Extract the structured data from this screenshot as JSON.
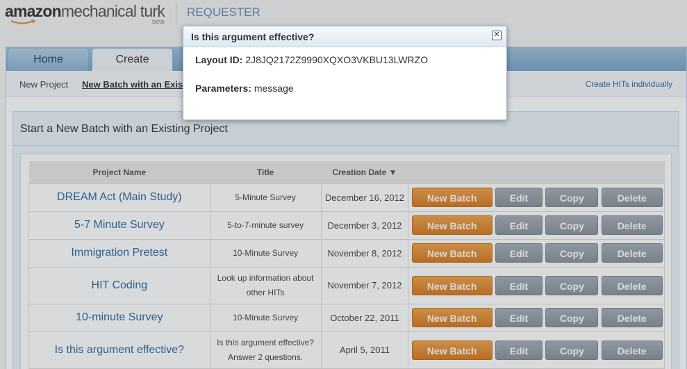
{
  "header": {
    "logo_bold": "amazon",
    "logo_rest": "mechanical turk",
    "logo_badge": "beta",
    "section": "REQUESTER"
  },
  "tabs": [
    {
      "label": "Home"
    },
    {
      "label": "Create"
    }
  ],
  "subnav": {
    "new_project": "New Project",
    "new_batch": "New Batch with an Existing Project",
    "individual": "Create HITs individually"
  },
  "panel": {
    "title": "Start a New Batch with an Existing Project"
  },
  "table": {
    "headers": {
      "name": "Project Name",
      "title": "Title",
      "date": "Creation Date ▼"
    },
    "rows": [
      {
        "name": "DREAM Act (Main Study)",
        "title": "5-Minute Survey",
        "date": "December 16, 2012"
      },
      {
        "name": "5-7 Minute Survey",
        "title": "5-to-7-minute survey",
        "date": "December 3, 2012"
      },
      {
        "name": "Immigration Pretest",
        "title": "10-Minute Survey",
        "date": "November 8, 2012"
      },
      {
        "name": "HIT Coding",
        "title": "Look up information about other HITs",
        "date": "November 7, 2012"
      },
      {
        "name": "10-minute Survey",
        "title": "10-Minute Survey",
        "date": "October 22, 2011"
      },
      {
        "name": "Is this argument effective?",
        "title": "Is this argument effective? Answer 2 questions.",
        "date": "April 5, 2011"
      }
    ],
    "buttons": {
      "new_batch": "New Batch",
      "edit": "Edit",
      "copy": "Copy",
      "delete": "Delete"
    }
  },
  "modal": {
    "title": "Is this argument effective?",
    "close_icon": "close-icon",
    "layout_label": "Layout ID:",
    "layout_value": "2J8JQ2172Z9990XQXO3VKBU13LWRZO",
    "params_label": "Parameters:",
    "params_value": "message"
  },
  "colors": {
    "accent_orange": "#e08a2c",
    "tab_blue": "#7aa5c6",
    "link_blue": "#2f6a9c"
  }
}
